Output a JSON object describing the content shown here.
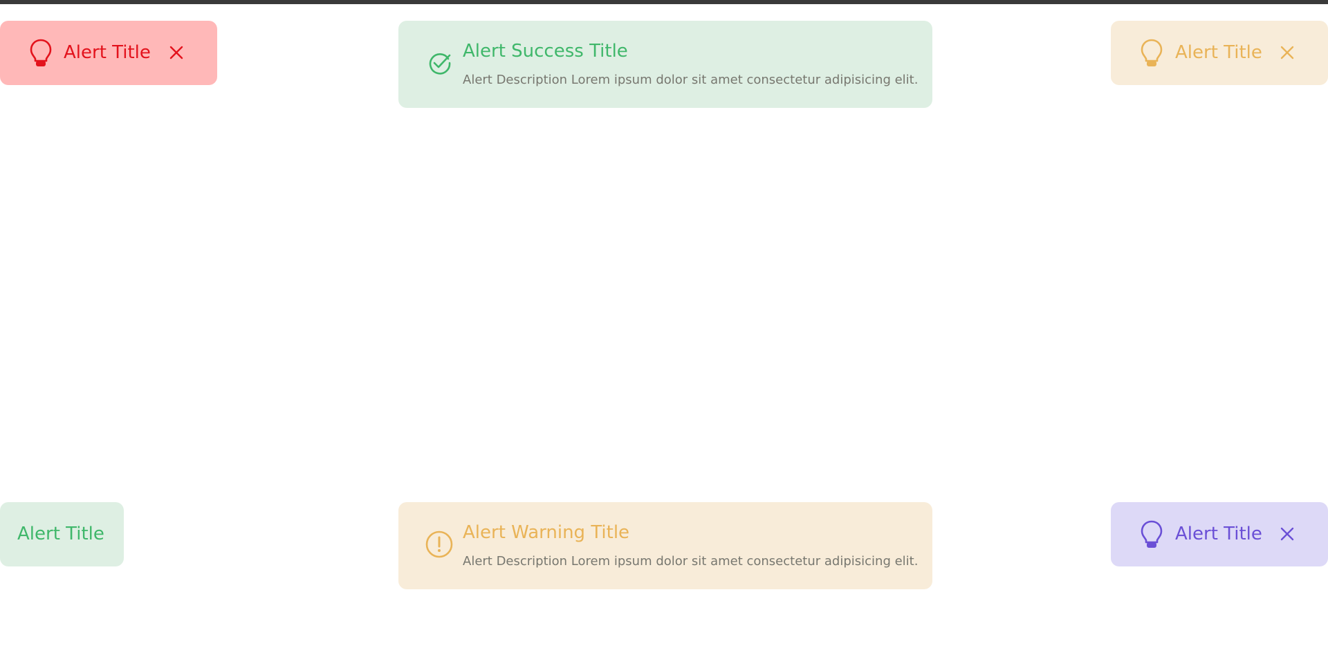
{
  "alerts": {
    "top_left": {
      "title": "Alert Title",
      "icon": "lightbulb-icon",
      "color": "#e3121c",
      "background": "#ffb8b8"
    },
    "top_center": {
      "title": "Alert Success Title",
      "description": "Alert Description Lorem ipsum dolor sit amet consectetur adipisicing elit.",
      "icon": "check-circle-icon",
      "color": "#3fb76a",
      "background": "#deefe3"
    },
    "top_right": {
      "title": "Alert Title",
      "icon": "lightbulb-icon",
      "color": "#e9b357",
      "background": "#f8ecd9"
    },
    "bottom_left": {
      "title": "Alert Title",
      "color": "#3fb76a",
      "background": "#deefe3"
    },
    "bottom_center": {
      "title": "Alert Warning Title",
      "description": "Alert Description Lorem ipsum dolor sit amet consectetur adipisicing elit.",
      "icon": "exclamation-circle-icon",
      "color": "#e9b357",
      "background": "#f8ecd9"
    },
    "bottom_right": {
      "title": "Alert Title",
      "icon": "lightbulb-icon",
      "color": "#6a4fd6",
      "background": "#ddd9f7"
    }
  },
  "close_icon": "close-icon"
}
